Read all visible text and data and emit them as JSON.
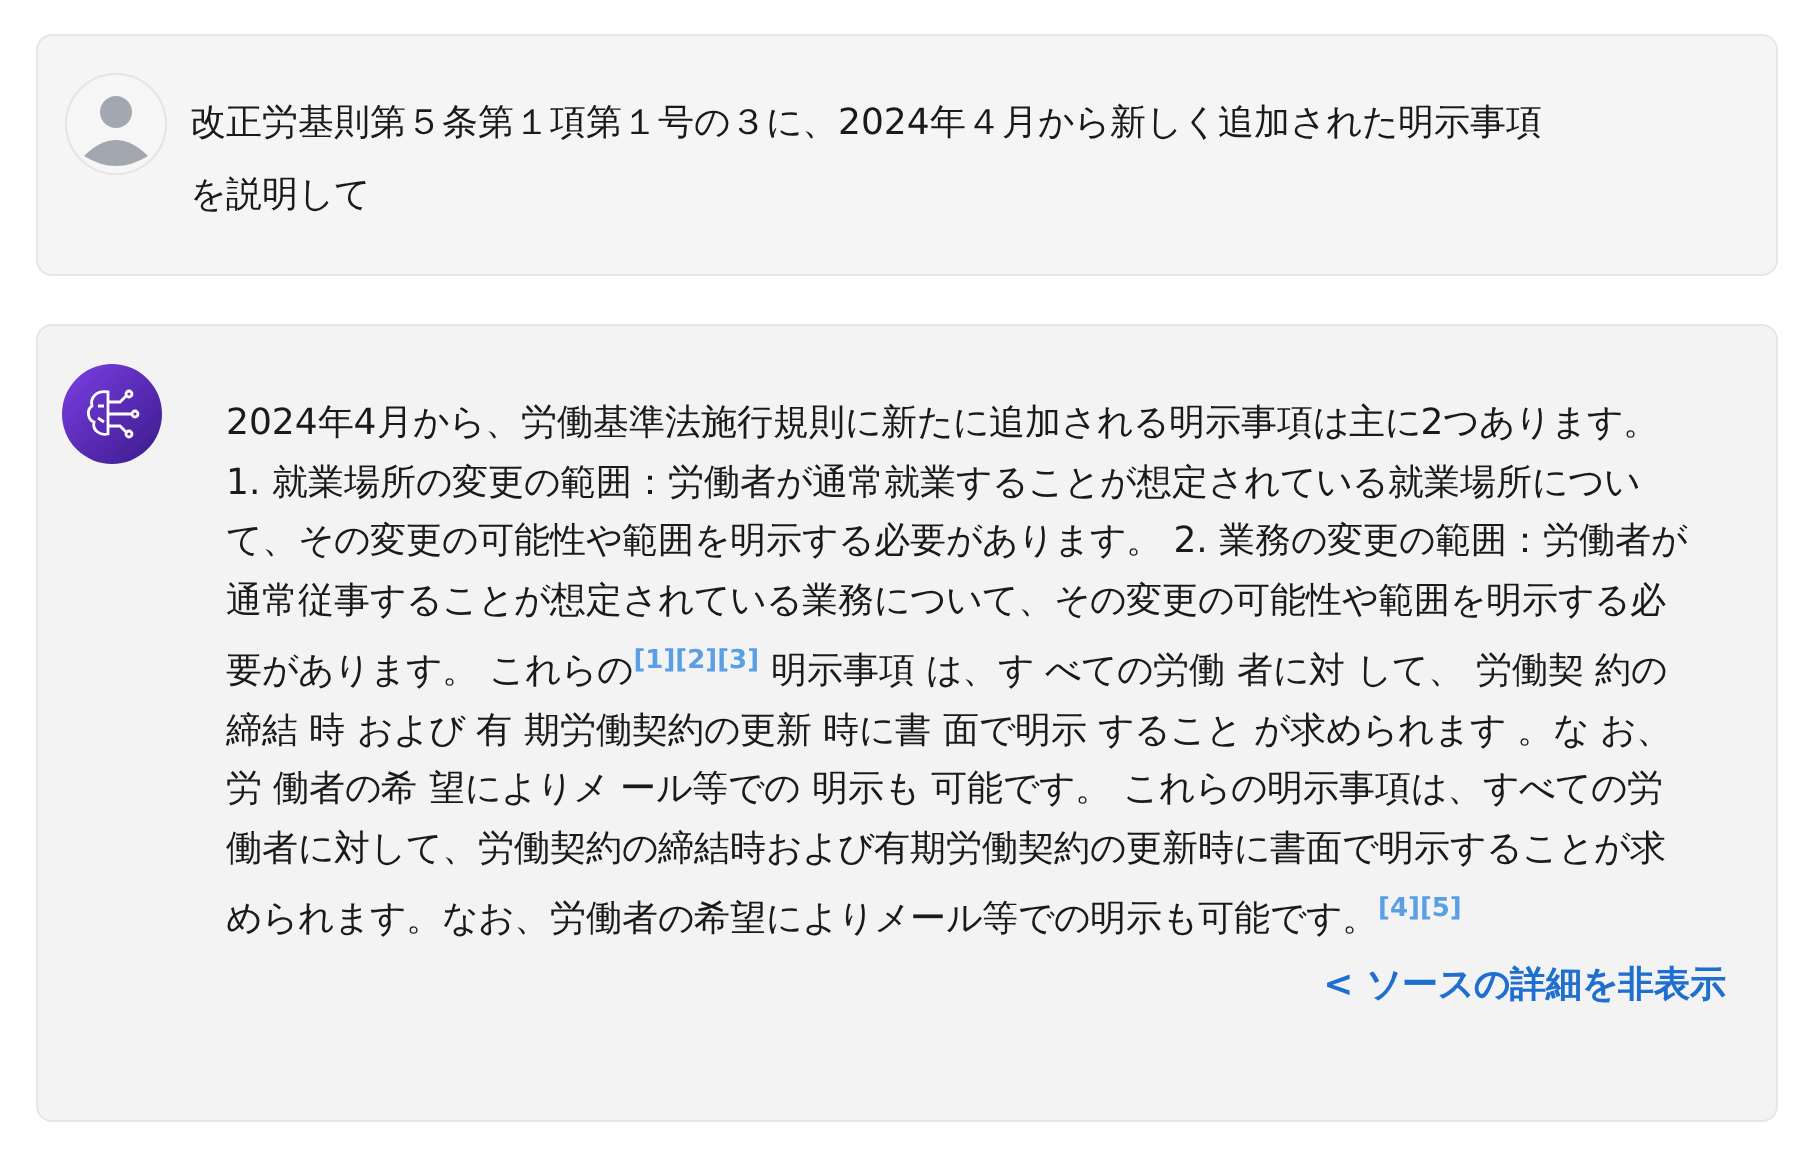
{
  "question": {
    "text": "改正労基則第５条第１項第１号の３に、2024年４月から新しく追加された明示事項を説明して"
  },
  "answer": {
    "segments": [
      {
        "kind": "text",
        "text": "2024年4月から、労働基準法施行規則に新たに追加される明示事項は主に2つあります。 1. 就業場所の変更の範囲：労働者が通常就業することが想定されている就業場所について、その変更の可能性や範囲を明示する必要があります。 2. 業務の変更の範囲：労働者が通常従事することが想定されている業務について、その変更の可能性や範囲を明示する必要があります。 これらの"
      },
      {
        "kind": "cite",
        "text": "[1]"
      },
      {
        "kind": "cite",
        "text": "[2]"
      },
      {
        "kind": "cite",
        "text": "[3]"
      },
      {
        "kind": "text",
        "text": " 明示事項 は、す べての労働 者に対 して、 労働契 約の締結 時 および 有 期労働契約の更新 時に書 面で明示 すること が求められます 。な お、労 働者の希 望によりメ ール等での 明示も 可能です。 これらの明示事項は、すべての労働者に対して、労働契約の締結時および有期労働契約の更新時に書面で明示することが求められます。なお、労働者の希望によりメール等での明示も可能です。"
      },
      {
        "kind": "cite",
        "text": "[4]"
      },
      {
        "kind": "cite",
        "text": "[5]"
      }
    ],
    "toggle": "< ソースの詳細を非表示"
  }
}
